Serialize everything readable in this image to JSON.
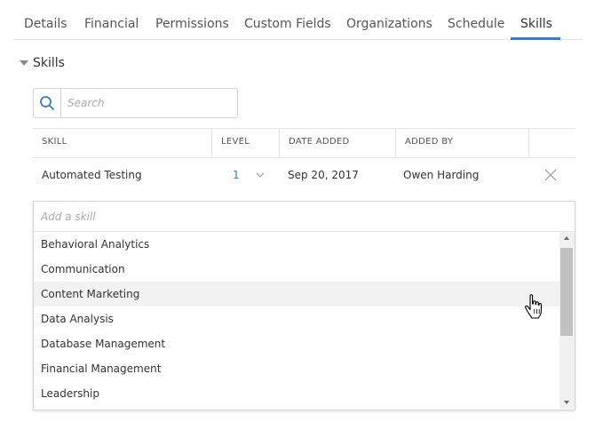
{
  "tabs": [
    {
      "label": "Details"
    },
    {
      "label": "Financial"
    },
    {
      "label": "Permissions"
    },
    {
      "label": "Custom Fields"
    },
    {
      "label": "Organizations"
    },
    {
      "label": "Schedule"
    },
    {
      "label": "Skills",
      "active": true
    }
  ],
  "section": {
    "title": "Skills",
    "expanded": true
  },
  "search": {
    "placeholder": "Search",
    "value": ""
  },
  "table": {
    "columns": [
      "SKILL",
      "LEVEL",
      "DATE ADDED",
      "ADDED BY"
    ],
    "rows": [
      {
        "skill": "Automated Testing",
        "level": "1",
        "date_added": "Sep 20, 2017",
        "added_by": "Owen Harding"
      }
    ]
  },
  "add_skill": {
    "placeholder": "Add a skill",
    "value": "",
    "options": [
      {
        "label": "Behavioral Analytics"
      },
      {
        "label": "Communication"
      },
      {
        "label": "Content Marketing",
        "hovered": true
      },
      {
        "label": "Data Analysis"
      },
      {
        "label": "Database Management"
      },
      {
        "label": "Financial Management"
      },
      {
        "label": "Leadership"
      }
    ]
  },
  "icons": {
    "search": "search-icon",
    "caret": "caret-down-icon",
    "level_dropdown": "chevron-down-icon",
    "remove": "close-icon",
    "cursor": "hand-cursor-icon"
  },
  "colors": {
    "accent": "#3a7bc8",
    "hover": "#f2f2f2",
    "border": "#d4d4d4"
  }
}
